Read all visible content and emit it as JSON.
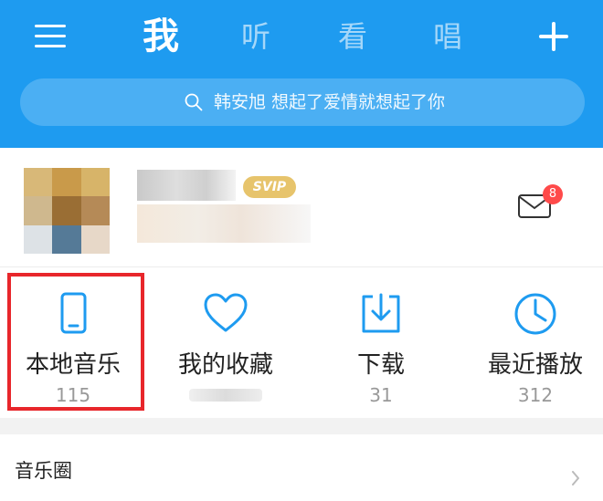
{
  "header": {
    "tabs": [
      "我",
      "听",
      "看",
      "唱"
    ],
    "active_tab": "我",
    "search_placeholder": "韩安旭 想起了爱情就想起了你"
  },
  "profile": {
    "vip_badge": "SVIP",
    "mail_badge_count": "8"
  },
  "quick_actions": [
    {
      "label": "本地音乐",
      "count": "115",
      "icon": "phone-icon"
    },
    {
      "label": "我的收藏",
      "count": "",
      "icon": "heart-icon"
    },
    {
      "label": "下载",
      "count": "31",
      "icon": "download-icon"
    },
    {
      "label": "最近播放",
      "count": "312",
      "icon": "clock-icon"
    }
  ],
  "list": {
    "music_circle_label": "音乐圈"
  },
  "colors": {
    "header_blue": "#1e9bf0",
    "icon_blue": "#1e9bf0",
    "highlight_red": "#e8262b",
    "vip_gold": "#e7c46c"
  }
}
